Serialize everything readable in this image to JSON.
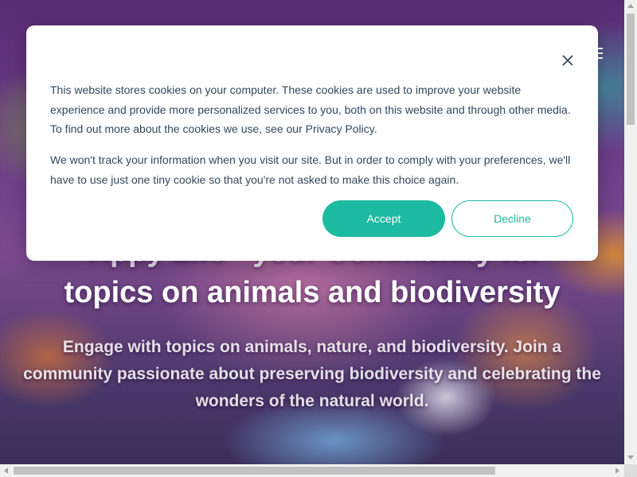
{
  "hero": {
    "title_line1": "Yippy Life - your Community for",
    "title_line2": "topics on animals and biodiversity",
    "subtitle": "Engage with topics on animals, nature, and biodiversity. Join a community passionate about preserving biodiversity and celebrating the wonders of the natural world.",
    "menu_icon": "hamburger-menu-icon"
  },
  "cookie_banner": {
    "paragraph1": "This website stores cookies on your computer. These cookies are used to improve your website experience and provide more personalized services to you, both on this website and through other media. To find out more about the cookies we use, see our Privacy Policy.",
    "paragraph2": "We won't track your information when you visit our site. But in order to comply with your preferences, we'll have to use just one tiny cookie so that you're not asked to make this choice again.",
    "accept_label": "Accept",
    "decline_label": "Decline",
    "close_icon": "close-icon",
    "accent_color": "#1cbaa0",
    "text_color": "#33475b"
  }
}
